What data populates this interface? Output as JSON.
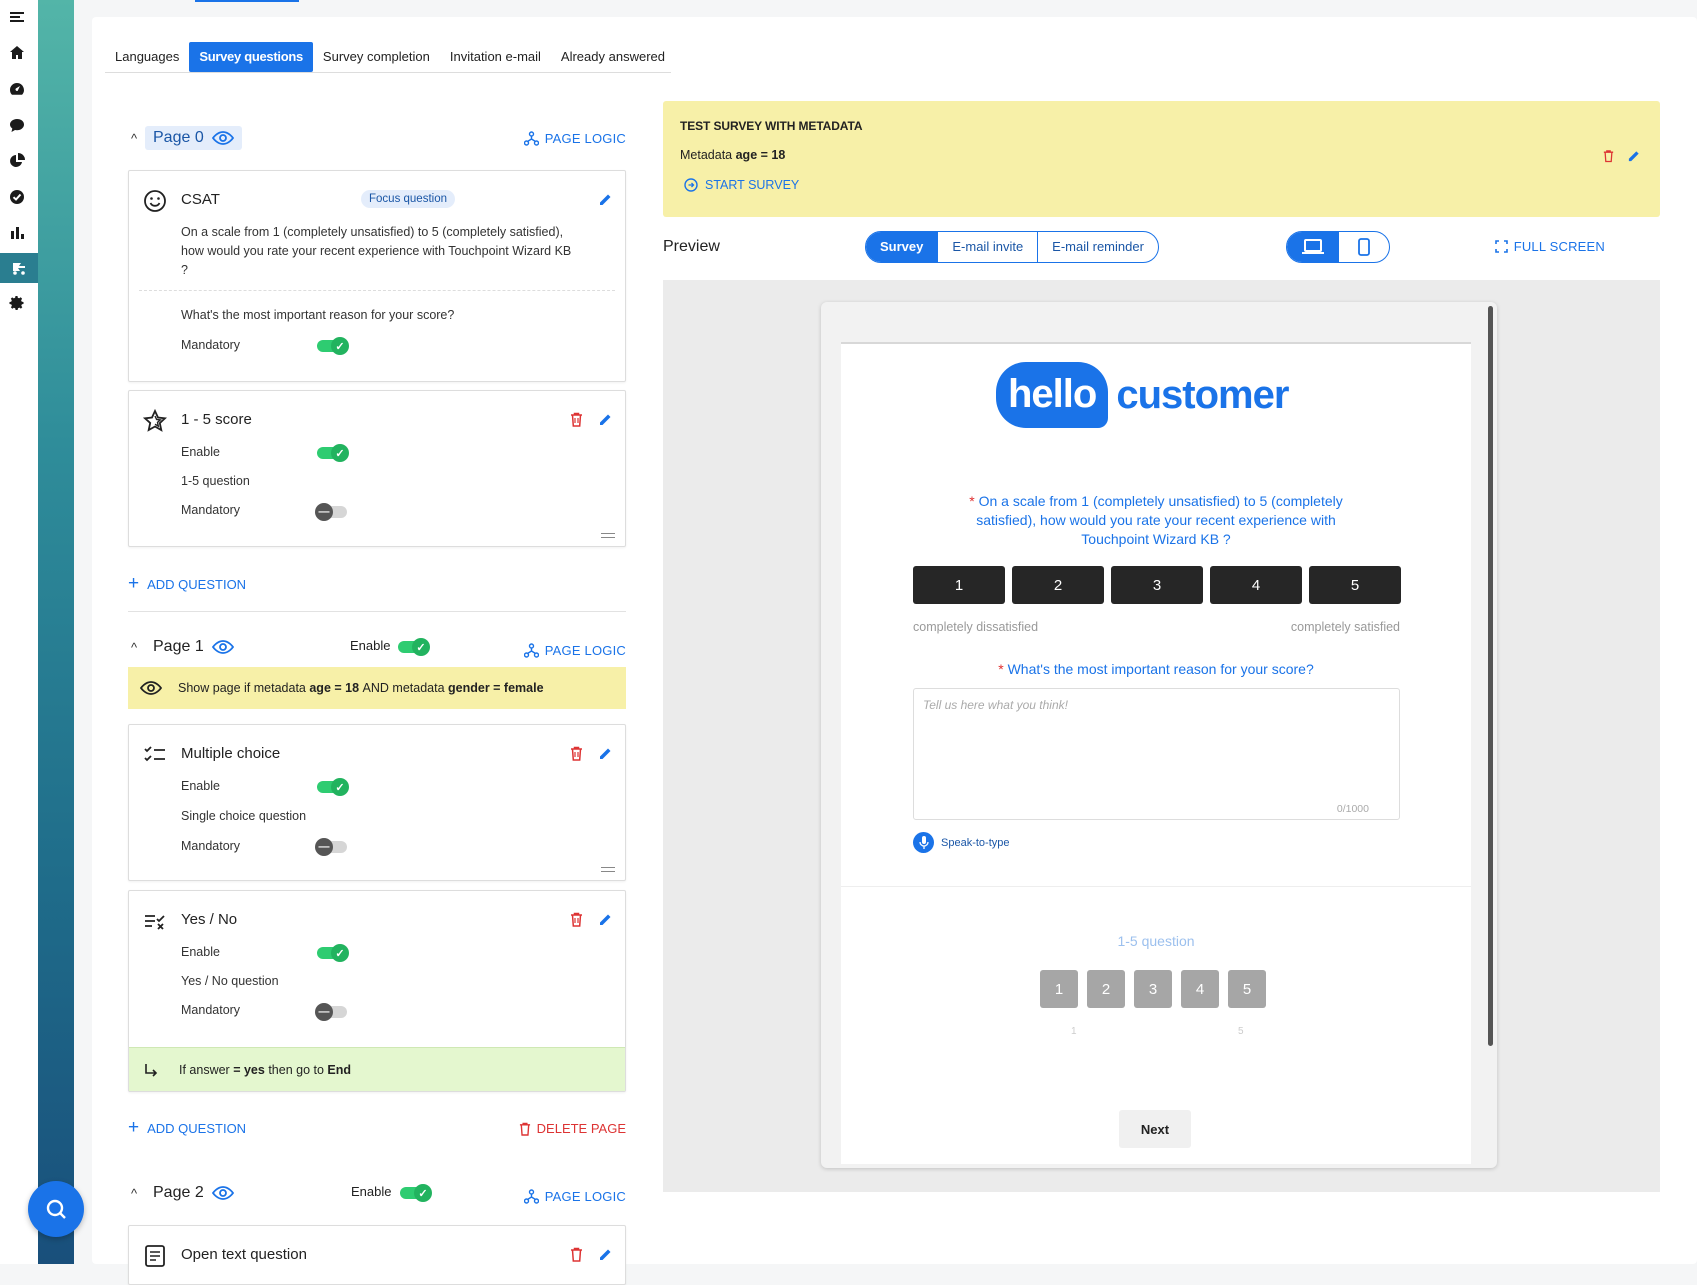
{
  "tabs": [
    "Languages",
    "Survey questions",
    "Survey completion",
    "Invitation e-mail",
    "Already answered"
  ],
  "page_logic_label": "PAGE LOGIC",
  "add_question_label": "ADD QUESTION",
  "delete_page_label": "DELETE PAGE",
  "enable_label": "Enable",
  "mandatory_label": "Mandatory",
  "page0": {
    "title": "Page 0",
    "csat": {
      "title": "CSAT",
      "badge": "Focus question",
      "question": "On a scale from 1 (completely unsatisfied) to 5 (completely satisfied), how would you rate your recent experience with Touchpoint Wizard KB ?",
      "followup": "What's the most important reason for your score?",
      "mandatory_on": true
    },
    "score": {
      "title": "1 - 5 score",
      "subtitle": "1-5 question",
      "enable_on": true,
      "mandatory_on": false
    }
  },
  "page1": {
    "title": "Page 1",
    "enable_on": true,
    "condition": {
      "pre": "Show page if metadata",
      "k1": "age = 18",
      "mid": "AND metadata",
      "k2": "gender = female"
    },
    "multiple": {
      "title": "Multiple choice",
      "subtitle": "Single choice question",
      "enable_on": true,
      "mandatory_on": false
    },
    "yesno": {
      "title": "Yes / No",
      "subtitle": "Yes / No question",
      "enable_on": true,
      "mandatory_on": false,
      "goto": {
        "pre": "If answer",
        "val": "= yes",
        "mid": "then go to",
        "target": "End"
      }
    }
  },
  "page2": {
    "title": "Page 2",
    "enable_on": true,
    "open": {
      "title": "Open text question"
    }
  },
  "test_survey": {
    "title": "TEST SURVEY WITH METADATA",
    "meta_label": "Metadata",
    "meta_value": "age = 18",
    "start": "START SURVEY"
  },
  "preview": {
    "label": "Preview",
    "modes": [
      "Survey",
      "E-mail invite",
      "E-mail reminder"
    ],
    "fullscreen": "FULL SCREEN"
  },
  "survey": {
    "logo_hello": "hello",
    "logo_customer": "customer",
    "q1": "On a scale from 1 (completely unsatisfied) to 5 (completely satisfied), how would you rate your recent experience with Touchpoint Wizard KB ?",
    "scale": [
      "1",
      "2",
      "3",
      "4",
      "5"
    ],
    "low_anchor": "completely dissatisfied",
    "high_anchor": "completely satisfied",
    "q2": "What's the most important reason for your score?",
    "placeholder": "Tell us here what you think!",
    "counter": "0/1000",
    "speak": "Speak-to-type",
    "q3": "1-5 question",
    "sm_low": "1",
    "sm_high": "5",
    "next": "Next"
  },
  "colors": {
    "accent": "#1a73e8",
    "toggle_on": "#2ecc71",
    "condition_bg": "#f7f0a8",
    "goto_bg": "#e4f7cf",
    "danger": "#dd3333"
  }
}
